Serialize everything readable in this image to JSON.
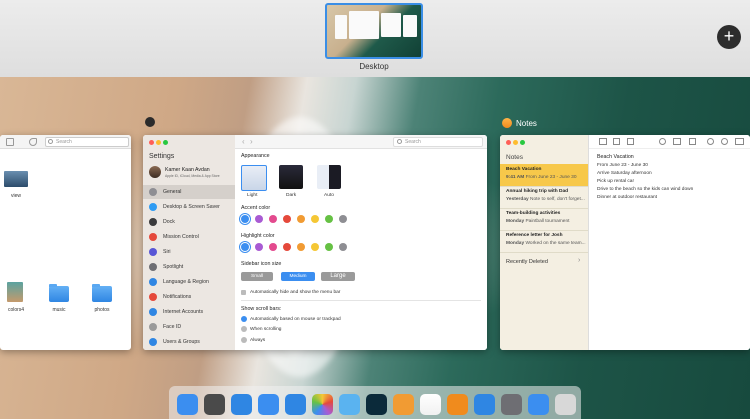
{
  "mission_control": {
    "space_label": "Desktop",
    "add_space_label": "+"
  },
  "finder": {
    "search_placeholder": "Search",
    "items": [
      {
        "label": "view"
      },
      {
        "label": "colors4"
      },
      {
        "label": "music"
      },
      {
        "label": "photos"
      }
    ]
  },
  "settings": {
    "title": "Settings",
    "search_placeholder": "Search",
    "user": {
      "name": "Kamer Kaan Avdan",
      "subtitle": "Apple ID, iCloud, Media & App Store"
    },
    "sidebar": [
      {
        "label": "General",
        "color": "#8e8e93"
      },
      {
        "label": "Desktop & Screen Saver",
        "color": "#2f9cf3"
      },
      {
        "label": "Dock",
        "color": "#3a3a3c"
      },
      {
        "label": "Mission Control",
        "color": "#e5493b"
      },
      {
        "label": "Siri",
        "color": "#5856d6"
      },
      {
        "label": "Spotlight",
        "color": "#6e6e73"
      },
      {
        "label": "Language & Region",
        "color": "#2f86e3"
      },
      {
        "label": "Notifications",
        "color": "#e5493b"
      },
      {
        "label": "Internet Accounts",
        "color": "#2f86e3"
      },
      {
        "label": "Face ID",
        "color": "#9a9a9a"
      },
      {
        "label": "Users & Groups",
        "color": "#2f86e3"
      }
    ],
    "appearance": {
      "title": "Appearance",
      "options": [
        "Light",
        "Dark",
        "Auto"
      ]
    },
    "accent_color": {
      "title": "Accent color",
      "colors": [
        "#3b8ef0",
        "#a95bd3",
        "#e34a8e",
        "#e5493b",
        "#f19b33",
        "#f5c735",
        "#66c144",
        "#8e8e93"
      ]
    },
    "highlight_color": {
      "title": "Highlight color",
      "colors": [
        "#3b8ef0",
        "#a95bd3",
        "#e34a8e",
        "#e5493b",
        "#f19b33",
        "#f5c735",
        "#66c144",
        "#8e8e93"
      ]
    },
    "sidebar_icon_size": {
      "title": "Sidebar icon size",
      "options": [
        "Small",
        "Medium",
        "Large"
      ],
      "selected": "Medium"
    },
    "auto_hide_menubar": "Automatically hide and show the menu bar",
    "scroll_bars": {
      "title": "Show scroll bars:",
      "options": [
        "Automatically based on mouse or trackpad",
        "When scrolling",
        "Always"
      ],
      "selected": "Automatically based on mouse or trackpad"
    }
  },
  "notes": {
    "app_label": "Notes",
    "list_title": "Notes",
    "items": [
      {
        "title": "Beach Vacation",
        "time": "9:41 AM",
        "detail": "From June 23 - June 30"
      },
      {
        "title": "Annual hiking trip with Dad",
        "time": "Yesterday",
        "detail": "Note to self, don't forget..."
      },
      {
        "title": "Team-building activities",
        "time": "Monday",
        "detail": "Paintball tournament"
      },
      {
        "title": "Reference letter for Josh",
        "time": "Monday",
        "detail": "Worked on the same team..."
      }
    ],
    "recently_deleted": "Recently Deleted",
    "body": {
      "title": "Beach Vacation",
      "lines": [
        "From June 23 - June 30",
        "Arrive Saturday afternoon",
        "Pick up rental car",
        "Drive to the beach so the kids can wind down",
        "Dinner at outdoor restaurant"
      ]
    }
  },
  "dock": {
    "apps": [
      {
        "name": "finder-icon",
        "color": "#3b8ef0"
      },
      {
        "name": "launchpad-icon",
        "color": "#4a4a4a"
      },
      {
        "name": "safari-icon",
        "color": "#2f86e3"
      },
      {
        "name": "mail-icon",
        "color": "#3b8ef0"
      },
      {
        "name": "messages-icon",
        "color": "#2f86e3"
      },
      {
        "name": "photos-icon",
        "color": "#f5f5f5"
      },
      {
        "name": "icloud-icon",
        "color": "#5ab3f0"
      },
      {
        "name": "photoshop-icon",
        "color": "#0b2a3a"
      },
      {
        "name": "pages-icon",
        "color": "#f19b33"
      },
      {
        "name": "music-icon",
        "color": "#f5f5f5"
      },
      {
        "name": "books-icon",
        "color": "#f08b1d"
      },
      {
        "name": "app-store-icon",
        "color": "#2f86e3"
      },
      {
        "name": "system-settings-icon",
        "color": "#6e6e73"
      },
      {
        "name": "downloads-icon",
        "color": "#3b8ef0"
      },
      {
        "name": "trash-icon",
        "color": "#d8d8d8"
      }
    ]
  }
}
